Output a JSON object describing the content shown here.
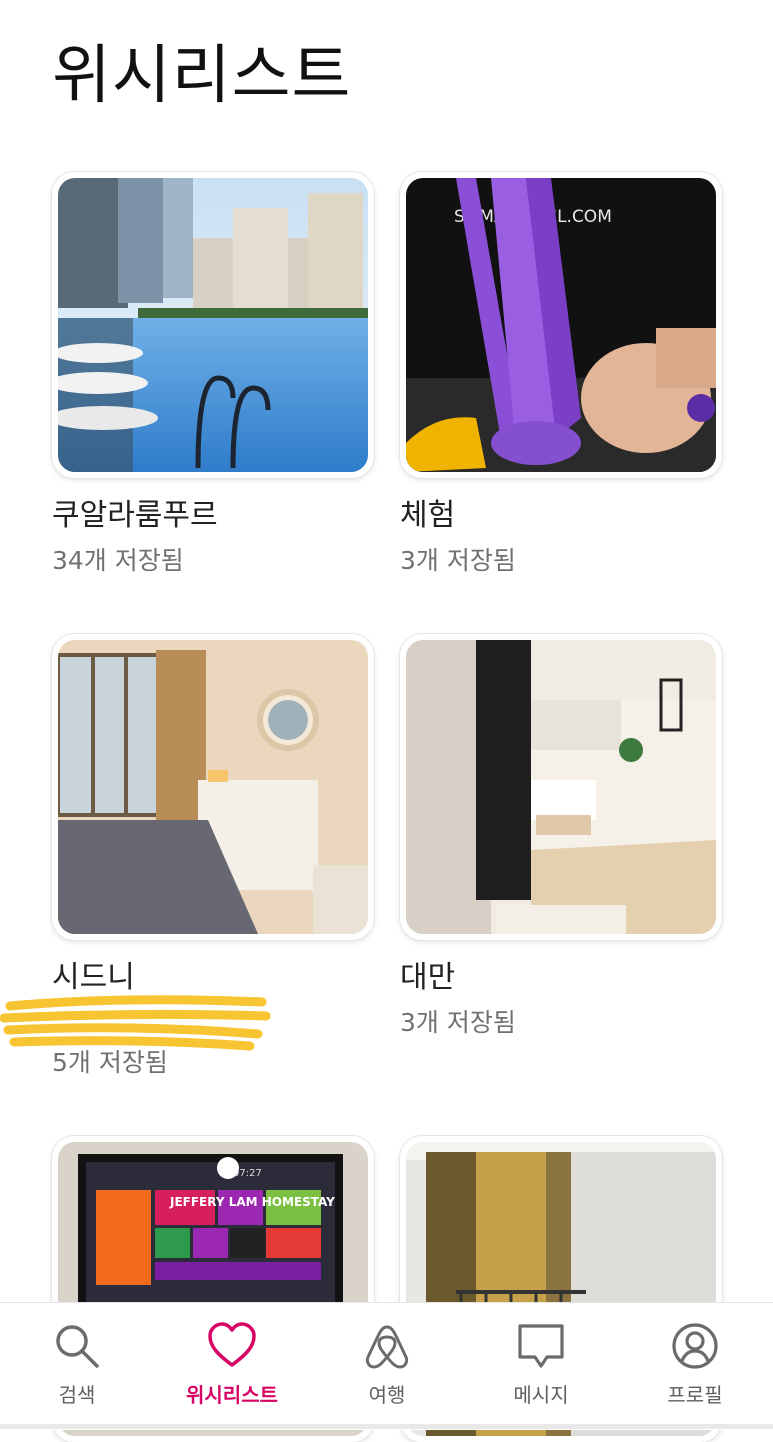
{
  "page": {
    "title": "위시리스트"
  },
  "wishlists": [
    {
      "name": "쿠알라룸푸르",
      "saved": "34개 저장됨",
      "image": "kuala-lumpur-rooftop-pool-photo"
    },
    {
      "name": "체험",
      "saved": "3개 저장됨",
      "image": "purple-slime-experience-photo",
      "image_text": "SLIMANKECIL.COM"
    },
    {
      "name": "시드니",
      "saved": "5개 저장됨",
      "image": "sydney-bedroom-photo",
      "redacted": true
    },
    {
      "name": "대만",
      "saved": "3개 저장됨",
      "image": "taiwan-apartment-photo"
    },
    {
      "name": "",
      "saved": "",
      "image": "tv-homestay-photo",
      "image_text": "JEFFERY LAM HOMESTAY",
      "image_time": "07:27"
    },
    {
      "name": "",
      "saved": "",
      "image": "bedroom-curtains-photo"
    }
  ],
  "bottom_nav": {
    "items": [
      {
        "label": "검색",
        "icon": "search-icon",
        "active": false
      },
      {
        "label": "위시리스트",
        "icon": "heart-icon",
        "active": true
      },
      {
        "label": "여행",
        "icon": "airbnb-logo-icon",
        "active": false
      },
      {
        "label": "메시지",
        "icon": "message-icon",
        "active": false
      },
      {
        "label": "프로필",
        "icon": "profile-icon",
        "active": false
      }
    ]
  },
  "colors": {
    "accent": "#d70466",
    "text": "#222222",
    "muted": "#717171",
    "highlight": "#f7c531"
  }
}
